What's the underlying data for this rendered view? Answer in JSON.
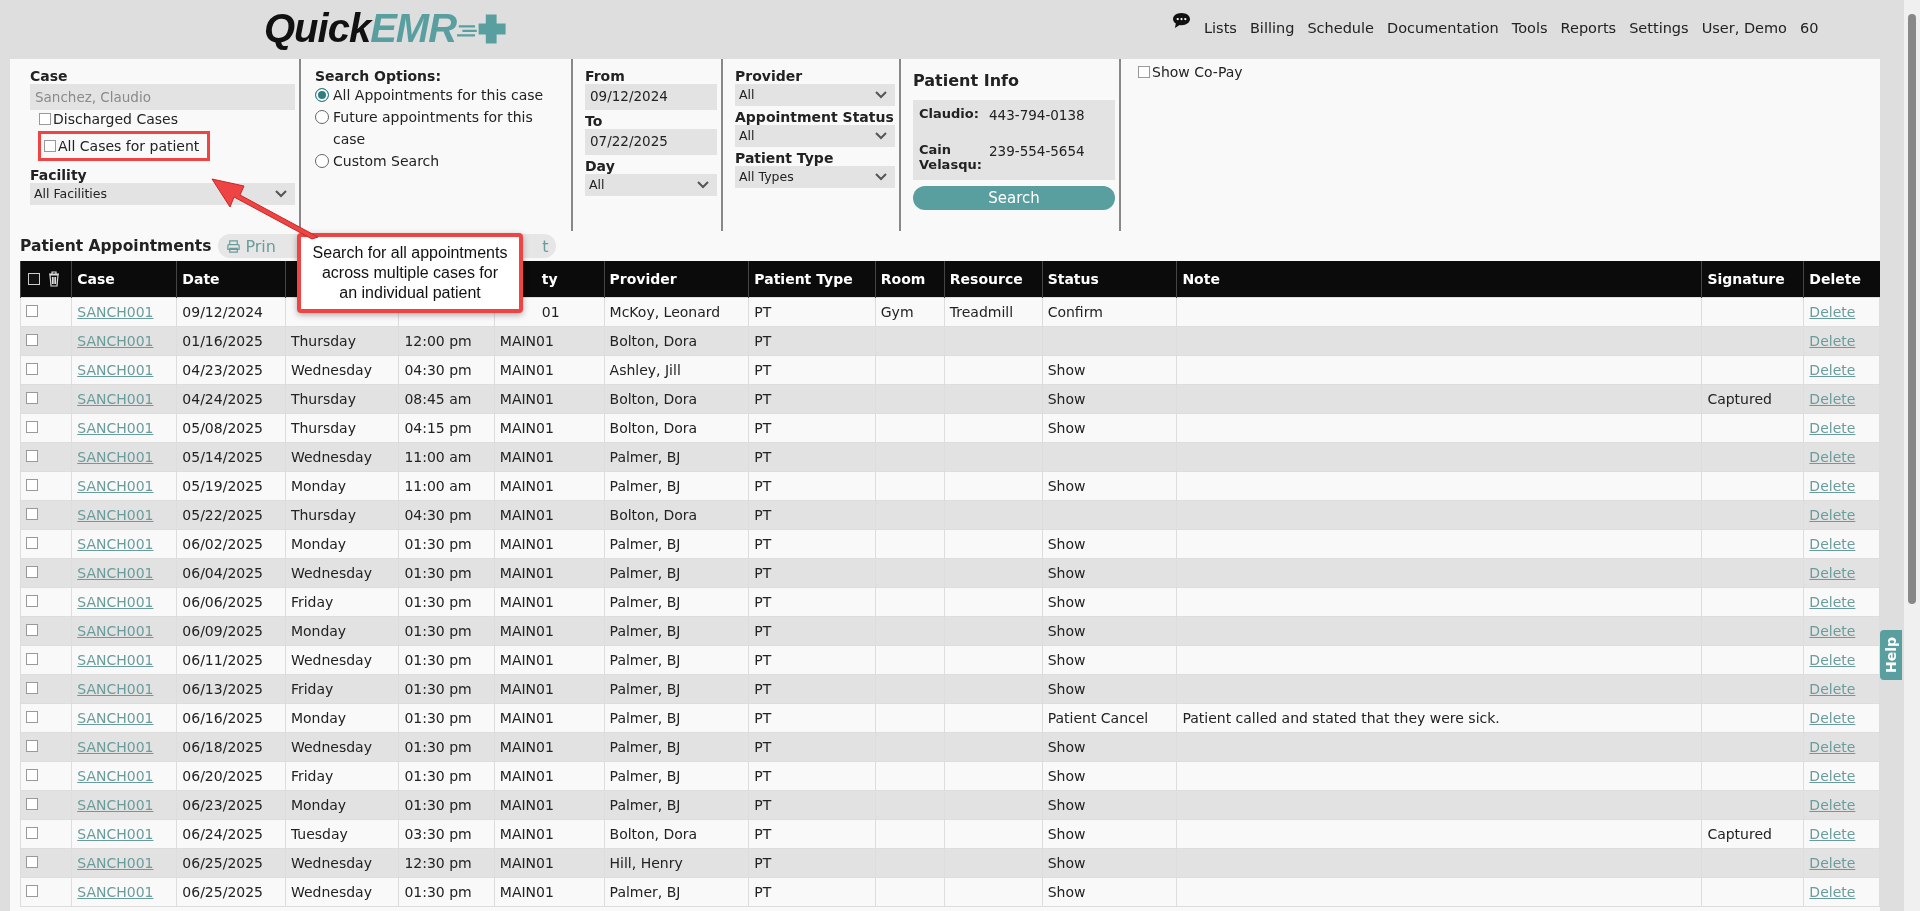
{
  "logo": {
    "part1": "Quick",
    "part2": "EMR"
  },
  "nav": [
    "Lists",
    "Billing",
    "Schedule",
    "Documentation",
    "Tools",
    "Reports",
    "Settings",
    "User, Demo",
    "60"
  ],
  "filters": {
    "case": {
      "label": "Case",
      "value": "Sanchez, Claudio",
      "disabled": true
    },
    "checkboxes": [
      {
        "label": "Discharged Cases",
        "checked": false
      },
      {
        "label": "All Cases for patient",
        "checked": false,
        "highlighted": true
      }
    ],
    "facility": {
      "label": "Facility",
      "value": "All Facilities"
    },
    "search_options": {
      "label": "Search Options:",
      "options": [
        {
          "label": "All Appointments for this case",
          "selected": true
        },
        {
          "label": "Future appointments for this case",
          "selected": false
        },
        {
          "label": "Custom Search",
          "selected": false
        }
      ]
    },
    "from": {
      "label": "From",
      "value": "09/12/2024"
    },
    "to": {
      "label": "To",
      "value": "07/22/2025"
    },
    "day": {
      "label": "Day",
      "value": "All"
    },
    "provider": {
      "label": "Provider",
      "value": "All"
    },
    "appointment_status": {
      "label": "Appointment Status",
      "value": "All"
    },
    "patient_type": {
      "label": "Patient Type",
      "value": "All Types"
    },
    "patient_info": {
      "title": "Patient Info",
      "contacts": [
        {
          "name": "Claudio:",
          "phone": "443-794-0138"
        },
        {
          "name": "Cain Velasqu:",
          "phone": "239-554-5654"
        }
      ],
      "button": "Search"
    },
    "show_copay": {
      "label": "Show Co-Pay",
      "checked": false
    }
  },
  "appointments_title": "Patient Appointments",
  "print_button": {
    "label": "Prin",
    "label_end": "t"
  },
  "callout": "Search for all appointments across multiple cases for an individual patient",
  "table": {
    "header_checked": false,
    "headers": {
      "case": "Case",
      "date": "Date",
      "facility": "ty",
      "provider": "Provider",
      "patient_type": "Patient Type",
      "room": "Room",
      "resource": "Resource",
      "status": "Status",
      "note": "Note",
      "signature": "Signature",
      "delete": "Delete"
    },
    "rows": [
      {
        "checked": false,
        "case": "SANCH001",
        "date": "09/12/2024",
        "facility": "01",
        "provider": "McKoy, Leonard",
        "patient_type": "PT",
        "room": "Gym",
        "resource": "Treadmill",
        "status": "Confirm",
        "delete": "Delete"
      },
      {
        "checked": false,
        "case": "SANCH001",
        "date": "01/16/2025",
        "day": "Thursday",
        "time": "12:00 pm",
        "facility": "MAIN01",
        "provider": "Bolton, Dora",
        "patient_type": "PT",
        "delete": "Delete"
      },
      {
        "checked": false,
        "case": "SANCH001",
        "date": "04/23/2025",
        "day": "Wednesday",
        "time": "04:30 pm",
        "facility": "MAIN01",
        "provider": "Ashley, Jill",
        "patient_type": "PT",
        "status": "Show",
        "delete": "Delete"
      },
      {
        "checked": false,
        "case": "SANCH001",
        "date": "04/24/2025",
        "day": "Thursday",
        "time": "08:45 am",
        "facility": "MAIN01",
        "provider": "Bolton, Dora",
        "patient_type": "PT",
        "status": "Show",
        "signature": "Captured",
        "delete": "Delete"
      },
      {
        "checked": false,
        "case": "SANCH001",
        "date": "05/08/2025",
        "day": "Thursday",
        "time": "04:15 pm",
        "facility": "MAIN01",
        "provider": "Bolton, Dora",
        "patient_type": "PT",
        "status": "Show",
        "delete": "Delete"
      },
      {
        "checked": false,
        "case": "SANCH001",
        "date": "05/14/2025",
        "day": "Wednesday",
        "time": "11:00 am",
        "facility": "MAIN01",
        "provider": "Palmer, BJ",
        "patient_type": "PT",
        "delete": "Delete"
      },
      {
        "checked": false,
        "case": "SANCH001",
        "date": "05/19/2025",
        "day": "Monday",
        "time": "11:00 am",
        "facility": "MAIN01",
        "provider": "Palmer, BJ",
        "patient_type": "PT",
        "status": "Show",
        "delete": "Delete"
      },
      {
        "checked": false,
        "case": "SANCH001",
        "date": "05/22/2025",
        "day": "Thursday",
        "time": "04:30 pm",
        "facility": "MAIN01",
        "provider": "Bolton, Dora",
        "patient_type": "PT",
        "delete": "Delete"
      },
      {
        "checked": false,
        "case": "SANCH001",
        "date": "06/02/2025",
        "day": "Monday",
        "time": "01:30 pm",
        "facility": "MAIN01",
        "provider": "Palmer, BJ",
        "patient_type": "PT",
        "status": "Show",
        "delete": "Delete"
      },
      {
        "checked": false,
        "case": "SANCH001",
        "date": "06/04/2025",
        "day": "Wednesday",
        "time": "01:30 pm",
        "facility": "MAIN01",
        "provider": "Palmer, BJ",
        "patient_type": "PT",
        "status": "Show",
        "delete": "Delete"
      },
      {
        "checked": false,
        "case": "SANCH001",
        "date": "06/06/2025",
        "day": "Friday",
        "time": "01:30 pm",
        "facility": "MAIN01",
        "provider": "Palmer, BJ",
        "patient_type": "PT",
        "status": "Show",
        "delete": "Delete"
      },
      {
        "checked": false,
        "case": "SANCH001",
        "date": "06/09/2025",
        "day": "Monday",
        "time": "01:30 pm",
        "facility": "MAIN01",
        "provider": "Palmer, BJ",
        "patient_type": "PT",
        "status": "Show",
        "delete": "Delete"
      },
      {
        "checked": false,
        "case": "SANCH001",
        "date": "06/11/2025",
        "day": "Wednesday",
        "time": "01:30 pm",
        "facility": "MAIN01",
        "provider": "Palmer, BJ",
        "patient_type": "PT",
        "status": "Show",
        "delete": "Delete"
      },
      {
        "checked": false,
        "case": "SANCH001",
        "date": "06/13/2025",
        "day": "Friday",
        "time": "01:30 pm",
        "facility": "MAIN01",
        "provider": "Palmer, BJ",
        "patient_type": "PT",
        "status": "Show",
        "delete": "Delete"
      },
      {
        "checked": false,
        "case": "SANCH001",
        "date": "06/16/2025",
        "day": "Monday",
        "time": "01:30 pm",
        "facility": "MAIN01",
        "provider": "Palmer, BJ",
        "patient_type": "PT",
        "status": "Patient Cancel",
        "note": "Patient called and stated that they were sick.",
        "delete": "Delete"
      },
      {
        "checked": false,
        "case": "SANCH001",
        "date": "06/18/2025",
        "day": "Wednesday",
        "time": "01:30 pm",
        "facility": "MAIN01",
        "provider": "Palmer, BJ",
        "patient_type": "PT",
        "status": "Show",
        "delete": "Delete"
      },
      {
        "checked": false,
        "case": "SANCH001",
        "date": "06/20/2025",
        "day": "Friday",
        "time": "01:30 pm",
        "facility": "MAIN01",
        "provider": "Palmer, BJ",
        "patient_type": "PT",
        "status": "Show",
        "delete": "Delete"
      },
      {
        "checked": false,
        "case": "SANCH001",
        "date": "06/23/2025",
        "day": "Monday",
        "time": "01:30 pm",
        "facility": "MAIN01",
        "provider": "Palmer, BJ",
        "patient_type": "PT",
        "status": "Show",
        "delete": "Delete"
      },
      {
        "checked": false,
        "case": "SANCH001",
        "date": "06/24/2025",
        "day": "Tuesday",
        "time": "03:30 pm",
        "facility": "MAIN01",
        "provider": "Bolton, Dora",
        "patient_type": "PT",
        "status": "Show",
        "signature": "Captured",
        "delete": "Delete"
      },
      {
        "checked": false,
        "case": "SANCH001",
        "date": "06/25/2025",
        "day": "Wednesday",
        "time": "12:30 pm",
        "facility": "MAIN01",
        "provider": "Hill, Henry",
        "patient_type": "PT",
        "status": "Show",
        "delete": "Delete"
      },
      {
        "checked": false,
        "case": "SANCH001",
        "date": "06/25/2025",
        "day": "Wednesday",
        "time": "01:30 pm",
        "facility": "MAIN01",
        "provider": "Palmer, BJ",
        "patient_type": "PT",
        "status": "Show",
        "delete": "Delete"
      }
    ]
  },
  "help_tab": "Help"
}
